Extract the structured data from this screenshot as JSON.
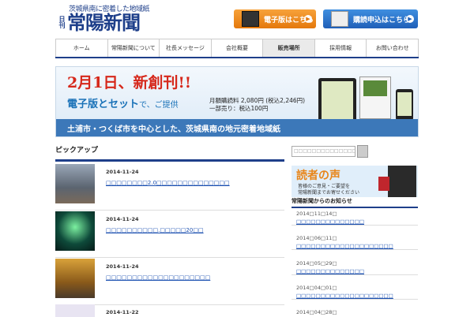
{
  "header": {
    "tagline": "茨城県南に密着した地域紙",
    "logo_small": "日刊",
    "logo_main": "常陽新聞",
    "digital_button": "電子版はこちら",
    "subscribe_button": "購読申込はこちら"
  },
  "nav": {
    "items": [
      "ホーム",
      "常陽新聞について",
      "社長メッセージ",
      "会社概要",
      "販売場所",
      "採用情報",
      "お問い合わせ"
    ],
    "active_index": 4
  },
  "banner": {
    "headline": "2月1日、新創刊!!",
    "sub_main": "電子版とセット",
    "sub_tail": "で、ご提供",
    "price_line1": "月額購読料 2,080円 (税込2,246円)",
    "price_line2": "一部売り：税込100円",
    "strip": "土浦市・つくば市を中心とした、茨城県南の地元密着地域紙"
  },
  "pickup": {
    "title": "ピックアップ",
    "rows": [
      {
        "date": "2014-11-24",
        "link": "□□□□□□□□2.0□□□□□□□□□□□□□□",
        "image": "group-photo"
      },
      {
        "date": "2014-11-24",
        "link": "□□□□□□□□□□.□□□□□20□□",
        "image": "illumination-photo"
      },
      {
        "date": "2014-11-24",
        "link": "□□□□□□□□□□□□□□□□□□□□",
        "image": "autumn-trees-photo"
      },
      {
        "date": "2014-11-22",
        "link": "",
        "image": "photo"
      }
    ]
  },
  "sidebar": {
    "search_placeholder": "□□□□□□□□□□□□□□",
    "voice_title": "読者の声",
    "voice_line1": "皆様のご意見・ご要望を",
    "voice_line2": "常陽新聞までお寄せください",
    "news_title": "常陽新聞からのお知らせ",
    "news": [
      {
        "date": "2014□11□14□",
        "link": "□□□□□□□□□□□□□□"
      },
      {
        "date": "2014□06□11□",
        "link": "□□□□□□□□□□□□□□□□□□□□"
      },
      {
        "date": "2014□05□29□",
        "link": "□□□□□□□□□□□□□□"
      },
      {
        "date": "2014□04□01□",
        "link": "□□□□□□□□□□□□□□□□□□□□"
      },
      {
        "date": "2014□04□28□",
        "link": ""
      }
    ]
  }
}
